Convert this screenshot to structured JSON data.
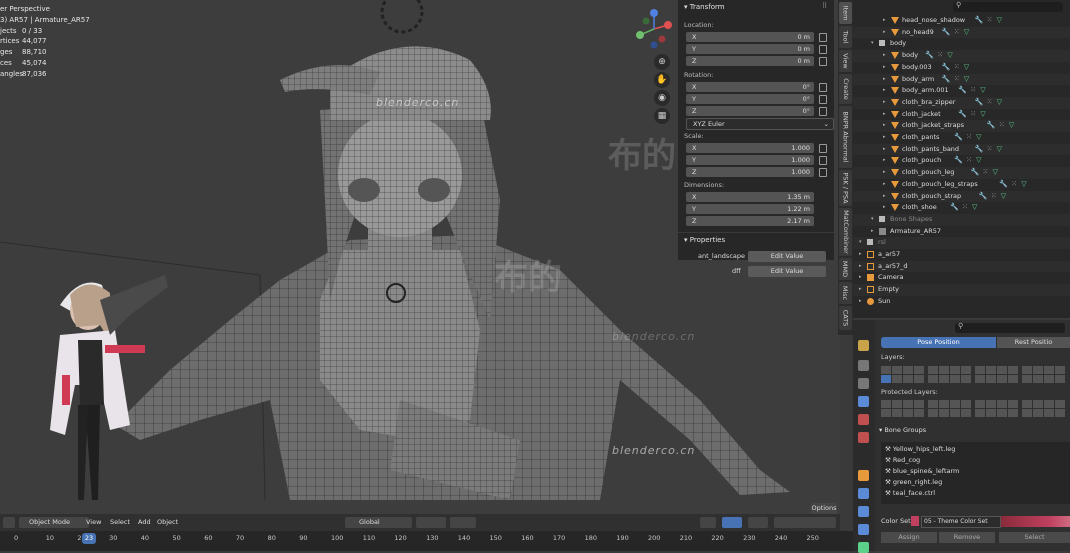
{
  "viewport": {
    "title_line": "er Perspective",
    "object_line": "3) AR57 | Armature_AR57",
    "stats": [
      {
        "label": "jects",
        "value": "0 / 33"
      },
      {
        "label": "rtices",
        "value": "44,077"
      },
      {
        "label": "ges",
        "value": "88,710"
      },
      {
        "label": "ces",
        "value": "45,074"
      },
      {
        "label": "angles",
        "value": "87,036"
      }
    ],
    "watermarks": [
      "blenderco.cn",
      "blenderco.cn",
      "blenderco.cn"
    ],
    "watermark_cn": [
      "布的",
      "布的"
    ]
  },
  "npanel": {
    "transform_title": "Transform",
    "location_label": "Location:",
    "location": [
      {
        "k": "X",
        "v": "0 m"
      },
      {
        "k": "Y",
        "v": "0 m"
      },
      {
        "k": "Z",
        "v": "0 m"
      }
    ],
    "rotation_label": "Rotation:",
    "rotation": [
      {
        "k": "X",
        "v": "0°"
      },
      {
        "k": "Y",
        "v": "0°"
      },
      {
        "k": "Z",
        "v": "0°"
      }
    ],
    "rotation_mode": "XYZ Euler",
    "scale_label": "Scale:",
    "scale": [
      {
        "k": "X",
        "v": "1.000"
      },
      {
        "k": "Y",
        "v": "1.000"
      },
      {
        "k": "Z",
        "v": "1.000"
      }
    ],
    "dimensions_label": "Dimensions:",
    "dimensions": [
      {
        "k": "X",
        "v": "1.35 m"
      },
      {
        "k": "Y",
        "v": "1.22 m"
      },
      {
        "k": "Z",
        "v": "2.17 m"
      }
    ],
    "properties_title": "Properties",
    "properties": [
      {
        "name": "ant_landscape",
        "button": "Edit Value"
      },
      {
        "name": "dff",
        "button": "Edit Value"
      }
    ]
  },
  "vtabs": [
    "Item",
    "Tool",
    "View",
    "Create",
    "BNPR Abnormal",
    "PSK / PSA",
    "MatCombiner",
    "MMD",
    "Misc",
    "CATS"
  ],
  "outliner": {
    "rows": [
      {
        "indent": 2,
        "name": "head_nose_shadow",
        "type": "mesh"
      },
      {
        "indent": 2,
        "name": "no_head9",
        "type": "mesh"
      },
      {
        "indent": 1,
        "name": "body",
        "type": "collection"
      },
      {
        "indent": 2,
        "name": "body",
        "type": "mesh"
      },
      {
        "indent": 2,
        "name": "body.003",
        "type": "mesh"
      },
      {
        "indent": 2,
        "name": "body_arm",
        "type": "mesh"
      },
      {
        "indent": 2,
        "name": "body_arm.001",
        "type": "mesh"
      },
      {
        "indent": 2,
        "name": "cloth_bra_zipper",
        "type": "mesh"
      },
      {
        "indent": 2,
        "name": "cloth_jacket",
        "type": "mesh"
      },
      {
        "indent": 2,
        "name": "cloth_jacket_straps",
        "type": "mesh"
      },
      {
        "indent": 2,
        "name": "cloth_pants",
        "type": "mesh"
      },
      {
        "indent": 2,
        "name": "cloth_pants_band",
        "type": "mesh"
      },
      {
        "indent": 2,
        "name": "cloth_pouch",
        "type": "mesh"
      },
      {
        "indent": 2,
        "name": "cloth_pouch_leg",
        "type": "mesh"
      },
      {
        "indent": 2,
        "name": "cloth_pouch_leg_straps",
        "type": "mesh"
      },
      {
        "indent": 2,
        "name": "cloth_pouch_strap",
        "type": "mesh"
      },
      {
        "indent": 2,
        "name": "cloth_shoe",
        "type": "mesh"
      },
      {
        "indent": 1,
        "name": "Bone Shapes",
        "type": "collection"
      },
      {
        "indent": 1,
        "name": "Armature_AR57",
        "type": "armature"
      },
      {
        "indent": 0,
        "name": "rsl",
        "type": "collection"
      },
      {
        "indent": 0,
        "name": "a_ar57",
        "type": "object"
      },
      {
        "indent": 0,
        "name": "a_ar57_d",
        "type": "object"
      },
      {
        "indent": 0,
        "name": "Camera",
        "type": "camera"
      },
      {
        "indent": 0,
        "name": "Empty",
        "type": "empty"
      },
      {
        "indent": 0,
        "name": "Sun",
        "type": "light"
      }
    ]
  },
  "props": {
    "pose_position": "Pose Position",
    "rest_position": "Rest Positio",
    "layers_label": "Layers:",
    "protected_layers_label": "Protected Layers:",
    "bone_groups_title": "Bone Groups",
    "bone_groups": [
      "Yellow_hips_left.leg",
      "Red_cog",
      "blue_spine&_leftarm",
      "green_right.leg",
      "teal_face.ctrl"
    ],
    "color_set_label": "Color Set:",
    "color_set_value": "05 - Theme Color Set",
    "assign": "Assign",
    "remove": "Remove",
    "select": "Select"
  },
  "header": {
    "mode": "Object Mode",
    "menus": [
      "View",
      "Select",
      "Add",
      "Object"
    ],
    "orientation": "Global",
    "options": "Options"
  },
  "timeline": {
    "ticks": [
      "0",
      "10",
      "20",
      "30",
      "40",
      "50",
      "60",
      "70",
      "80",
      "90",
      "100",
      "110",
      "120",
      "130",
      "140",
      "150",
      "160",
      "170",
      "180",
      "190",
      "200",
      "210",
      "220",
      "230",
      "240",
      "250"
    ],
    "current_frame": "23"
  },
  "colors": {
    "accent": "#4772b3",
    "mesh_icon": "#e79a3c",
    "modifier": "#6aa0e8",
    "material": "#5bd18a",
    "color_set": "#c04060"
  }
}
